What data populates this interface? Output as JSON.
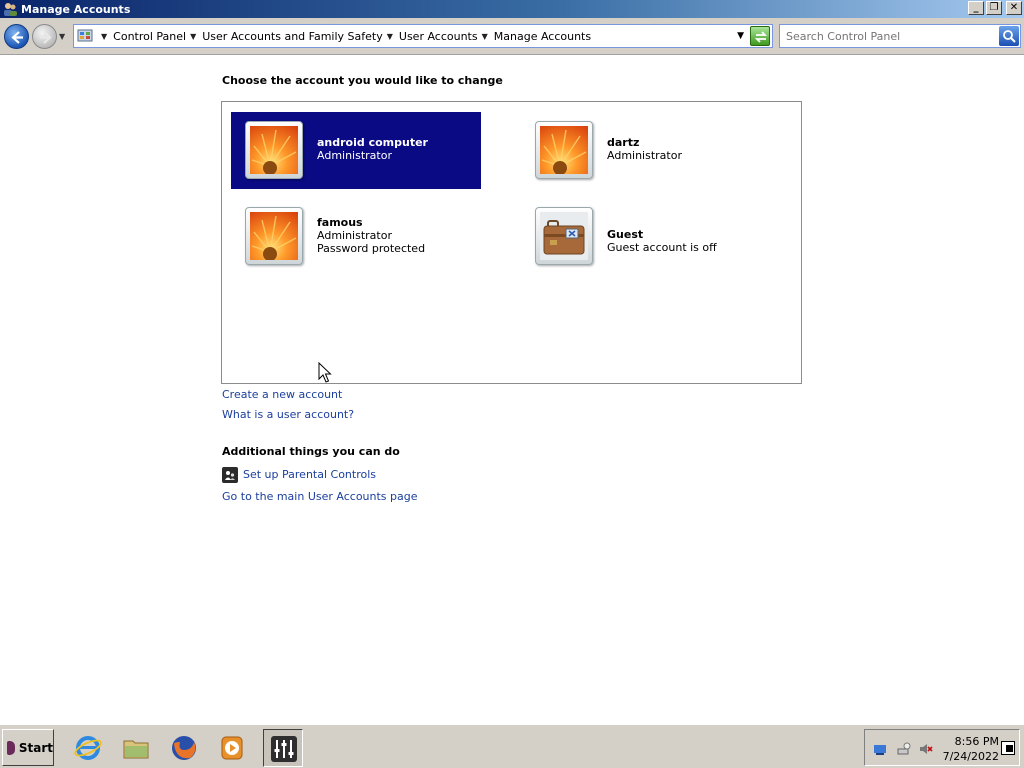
{
  "window": {
    "title": "Manage Accounts",
    "controls": {
      "minimize": "_",
      "restore": "❐",
      "close": "✕"
    }
  },
  "address": {
    "breadcrumbs": [
      "Control Panel",
      "User Accounts and Family Safety",
      "User Accounts",
      "Manage Accounts"
    ],
    "search_placeholder": "Search Control Panel"
  },
  "main": {
    "choose_heading": "Choose the account you would like to change",
    "accounts": [
      {
        "name": "android computer",
        "lines": [
          "Administrator"
        ],
        "picture": "flower-icon",
        "selected": true
      },
      {
        "name": "dartz",
        "lines": [
          "Administrator"
        ],
        "picture": "flower-icon",
        "selected": false
      },
      {
        "name": "famous",
        "lines": [
          "Administrator",
          "Password protected"
        ],
        "picture": "flower-icon",
        "selected": false
      },
      {
        "name": "Guest",
        "lines": [
          "Guest account is off"
        ],
        "picture": "suitcase-icon",
        "selected": false
      }
    ],
    "links": {
      "create_account": "Create a new account",
      "what_is_account": "What is a user account?"
    },
    "additional_heading": "Additional things you can do",
    "additional_links": {
      "parental_controls": "Set up Parental Controls",
      "main_user_accounts": "Go to the main User Accounts page"
    }
  },
  "taskbar": {
    "start_label": "Start",
    "apps": [
      "internet-explorer-icon",
      "file-explorer-icon",
      "firefox-icon",
      "media-player-icon",
      "mixer-icon"
    ],
    "tray_icons": [
      "network-icon",
      "connection-icon",
      "volume-muted-icon"
    ],
    "clock_time": "8:56 PM",
    "clock_date": "7/24/2022"
  },
  "colors": {
    "selection": "#0a0a84",
    "link": "#1b3f9e",
    "titlebar": "#0a246a"
  }
}
